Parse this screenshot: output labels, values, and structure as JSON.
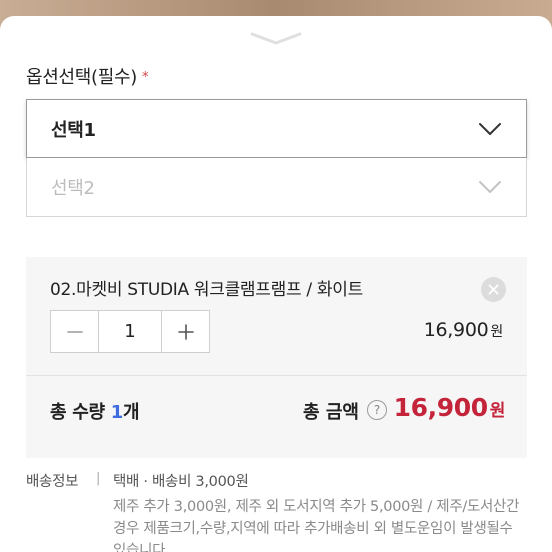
{
  "option_section": {
    "title": "옵션선택(필수)",
    "required_mark": "*",
    "select1_label": "선택1",
    "select2_label": "선택2"
  },
  "selected_item": {
    "name": "02.마켓비 STUDIA 워크클램프램프 / 화이트",
    "quantity": "1",
    "minus_symbol": "−",
    "plus_symbol": "+",
    "price": "16,900",
    "price_unit": "원"
  },
  "totals": {
    "quantity_prefix": "총 수량 ",
    "quantity_value": "1",
    "quantity_suffix": "개",
    "amount_label": "총 금액",
    "help_symbol": "?",
    "amount_value": "16,900",
    "amount_unit": "원"
  },
  "shipping": {
    "label": "배송정보",
    "separator": "|",
    "summary": "택배 · 배송비 3,000원",
    "note": "제주 추가 3,000원, 제주 외 도서지역 추가 5,000원 / 제주/도서산간 경우 제품크기,수량,지역에 따라 추가배송비 외 별도운임이 발생될수 있습니다."
  },
  "colors": {
    "accent_price": "#c4243a",
    "accent_quantity": "#3f6de0",
    "required": "#d54040"
  },
  "icons": [
    "sheet-handle-icon",
    "chevron-down-icon",
    "close-icon",
    "help-icon"
  ]
}
